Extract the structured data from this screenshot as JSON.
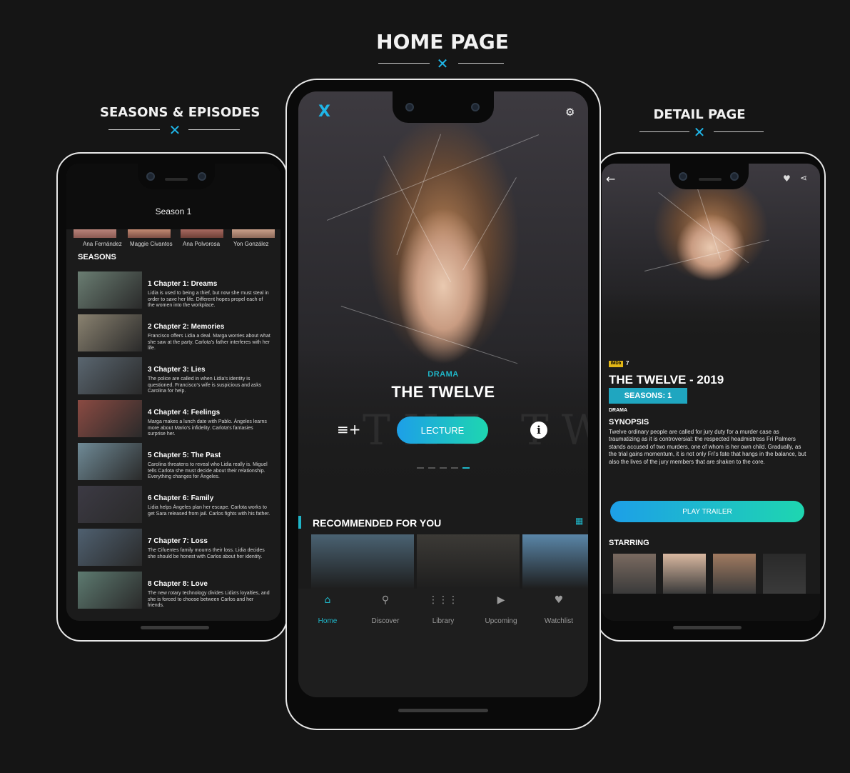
{
  "headings": {
    "home": "HOME PAGE",
    "seasons": "SEASONS & EPISODES",
    "detail": "DETAIL PAGE",
    "deco_mark": "✕"
  },
  "seasons_screen": {
    "season_label": "Season 1",
    "cast": [
      "Ana Fernández",
      "Maggie Civantos",
      "Ana Polvorosa",
      "Yon González"
    ],
    "section_title": "SEASONS",
    "episodes": [
      {
        "title": "1   Chapter 1: Dreams",
        "desc": "Lidia is used to being a thief, but now she must steal in order to save her life. Different hopes propel each of the women into the workplace."
      },
      {
        "title": "2   Chapter 2: Memories",
        "desc": "Francisco offers Lidia a deal. Marga worries about what she saw at the party. Carlota's father interferes with her life."
      },
      {
        "title": "3   Chapter 3: Lies",
        "desc": "The police are called in when Lidia's identity is questioned. Francisco's wife is suspicious and asks Carolina for help."
      },
      {
        "title": "4   Chapter 4: Feelings",
        "desc": "Marga makes a lunch date with Pablo. Ángeles learns more about Mario's infidelity. Carlota's fantasies surprise her."
      },
      {
        "title": "5   Chapter 5: The Past",
        "desc": "Carolina threatens to reveal who Lidia really is. Miguel tells Carlota she must decide about their relationship. Everything changes for Ángeles."
      },
      {
        "title": "6   Chapter 6: Family",
        "desc": "Lidia helps Ángeles plan her escape. Carlota works to get Sara released from jail. Carlos fights with his father."
      },
      {
        "title": "7   Chapter 7: Loss",
        "desc": "The Cifuentes family mourns their loss. Lidia decides she should be honest with Carlos about her identity."
      },
      {
        "title": "8   Chapter 8: Love",
        "desc": "The new rotary technology divides Lidia's loyalties, and she is forced to choose between Carlos and her friends."
      }
    ],
    "thumb_colors": [
      "#6a7d72",
      "#8a8270",
      "#5a6670",
      "#8a4a42",
      "#6f8a96",
      "#3c3a44",
      "#4f6070",
      "#5d7a70"
    ]
  },
  "home_screen": {
    "logo": "X",
    "genre": "DRAMA",
    "title": "THE TWELVE",
    "watermark": "THE TWELVE",
    "cta": "LECTURE",
    "info": "i",
    "section_title": "RECOMMENDED FOR YOU",
    "tile_colors": [
      "#4a6272",
      "#3c3a36",
      "#5a86a8"
    ],
    "nav": [
      {
        "label": "Home",
        "icon": "home-icon",
        "glyph": "⌂",
        "active": true
      },
      {
        "label": "Discover",
        "icon": "search-icon",
        "glyph": "⚲",
        "active": false
      },
      {
        "label": "Library",
        "icon": "grid-icon",
        "glyph": "⋮⋮⋮",
        "active": false
      },
      {
        "label": "Upcoming",
        "icon": "play-screen-icon",
        "glyph": "▶",
        "active": false
      },
      {
        "label": "Watchlist",
        "icon": "heart-icon",
        "glyph": "♥",
        "active": false
      }
    ],
    "accent": "#1fb6c8"
  },
  "detail_screen": {
    "imdb_badge": "IMDb",
    "imdb_score": "7",
    "title": "THE TWELVE - 2019",
    "seasons": "SEASONS: 1",
    "genre": "DRAMA",
    "synopsis_label": "SYNOPSIS",
    "synopsis": "Twelve ordinary people are called for jury duty for a murder case as traumatizing as it is controversial: the respected headmistress Fri Palmers stands accused of two murders, one of whom is her own child. Gradually, as the trial gains momentum, it is not only Fri's fate that hangs in the balance, but also the lives of the jury members that are shaken to the core.",
    "trailer_button": "PLAY TRAILER",
    "starring_label": "STARRING",
    "star_colors": [
      "#7a6a60",
      "#d9b8a0",
      "#a07a60",
      "#2a2a2a"
    ]
  }
}
